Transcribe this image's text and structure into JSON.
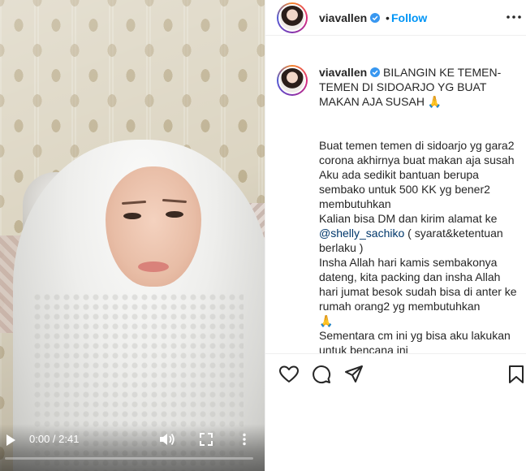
{
  "post": {
    "username": "viavallen",
    "follow_label": "Follow",
    "dot": "•"
  },
  "video": {
    "time": "0:00 / 2:41",
    "progress": 0.0,
    "play_icon": "play-icon",
    "volume_icon": "volume-icon",
    "fullscreen_icon": "fullscreen-icon",
    "more_icon": "more-vertical-icon"
  },
  "caption": {
    "username": "viavallen",
    "headline": "BILANGIN KE TEMEN-TEMEN DI SIDOARJO YG BUAT MAKAN AJA SUSAH 🙏",
    "lines": [
      "Buat temen temen di sidoarjo yg gara2 corona akhirnya buat makan aja susah",
      "Aku ada sedikit bantuan berupa sembako untuk 500 KK yg bener2 membutuhkan",
      "Kalian bisa DM dan kirim alamat ke"
    ],
    "mention": "@shelly_sachiko",
    "mention_suffix": " ( syarat&ketentuan berlaku )",
    "lines2": [
      "Insha Allah hari kamis sembakonya dateng, kita packing dan insha Allah hari jumat besok sudah bisa di anter ke rumah orang2 yg membutuhkan",
      "🙏",
      "Sementara cm ini yg bisa aku lakukan untuk bencana ini"
    ]
  },
  "actions": {
    "like_icon": "heart-icon",
    "comment_icon": "comment-icon",
    "share_icon": "share-icon",
    "save_icon": "bookmark-icon"
  },
  "colors": {
    "follow": "#0095f6",
    "verified": "#3897f0",
    "text": "#262626"
  }
}
